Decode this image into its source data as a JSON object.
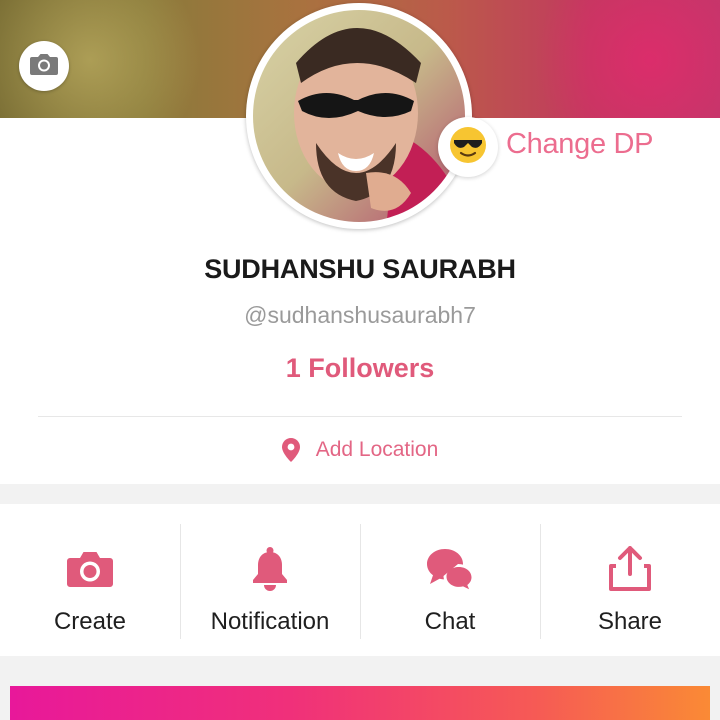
{
  "cover": {
    "camera_icon": "camera-icon"
  },
  "profile": {
    "dp_emoji_icon": "sunglasses-face-emoji-icon",
    "change_dp_label": "Change DP",
    "name": "SUDHANSHU SAURABH",
    "handle": "@sudhanshusaurabh7",
    "followers": "1 Followers",
    "location_icon": "map-pin-icon",
    "location_label": "Add Location"
  },
  "actions": [
    {
      "label": "Create",
      "icon": "camera-icon"
    },
    {
      "label": "Notification",
      "icon": "bell-icon"
    },
    {
      "label": "Chat",
      "icon": "chat-bubbles-icon"
    },
    {
      "label": "Share",
      "icon": "share-icon"
    }
  ],
  "colors": {
    "accent": "#ec6d8f",
    "icon_accent": "#e05a7b",
    "text_dark": "#1a1a1a",
    "text_muted": "#9a9a9a"
  }
}
